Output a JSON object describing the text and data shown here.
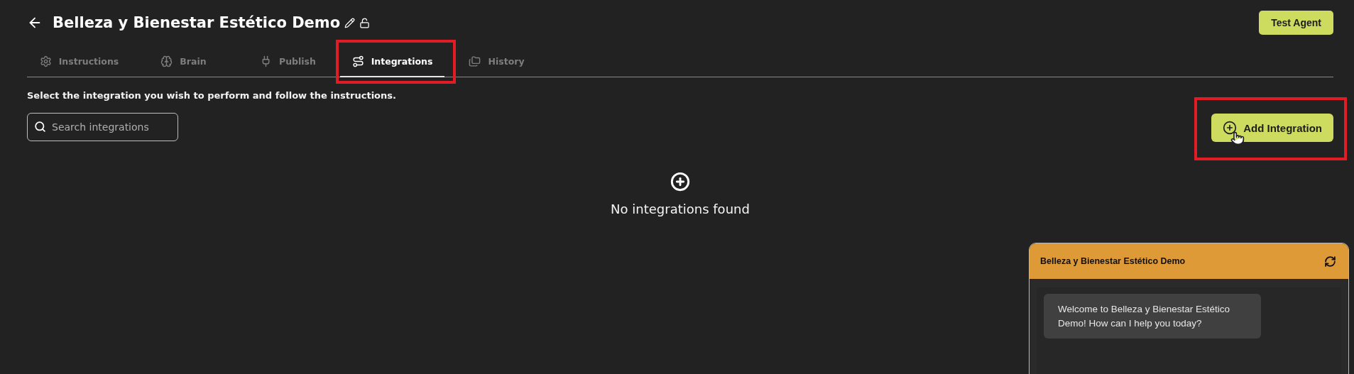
{
  "header": {
    "title": "Belleza y Bienestar Estético Demo",
    "test_button": "Test Agent"
  },
  "tabs": [
    {
      "label": "Instructions",
      "kind": "gear",
      "selected": false
    },
    {
      "label": "Brain",
      "kind": "brain",
      "selected": false
    },
    {
      "label": "Publish",
      "kind": "plug",
      "selected": false
    },
    {
      "label": "Integrations",
      "kind": "route",
      "selected": true
    },
    {
      "label": "History",
      "kind": "folders",
      "selected": false
    }
  ],
  "description": "Select the integration you wish to perform and follow the instructions.",
  "search": {
    "placeholder": "Search integrations"
  },
  "add_button": "Add Integration",
  "empty_state": {
    "message": "No integrations found"
  },
  "chat": {
    "title": "Belleza y Bienestar Estético Demo",
    "messages": [
      {
        "text": "Welcome to Belleza y Bienestar Estético Demo! How can I help you today?"
      }
    ]
  }
}
